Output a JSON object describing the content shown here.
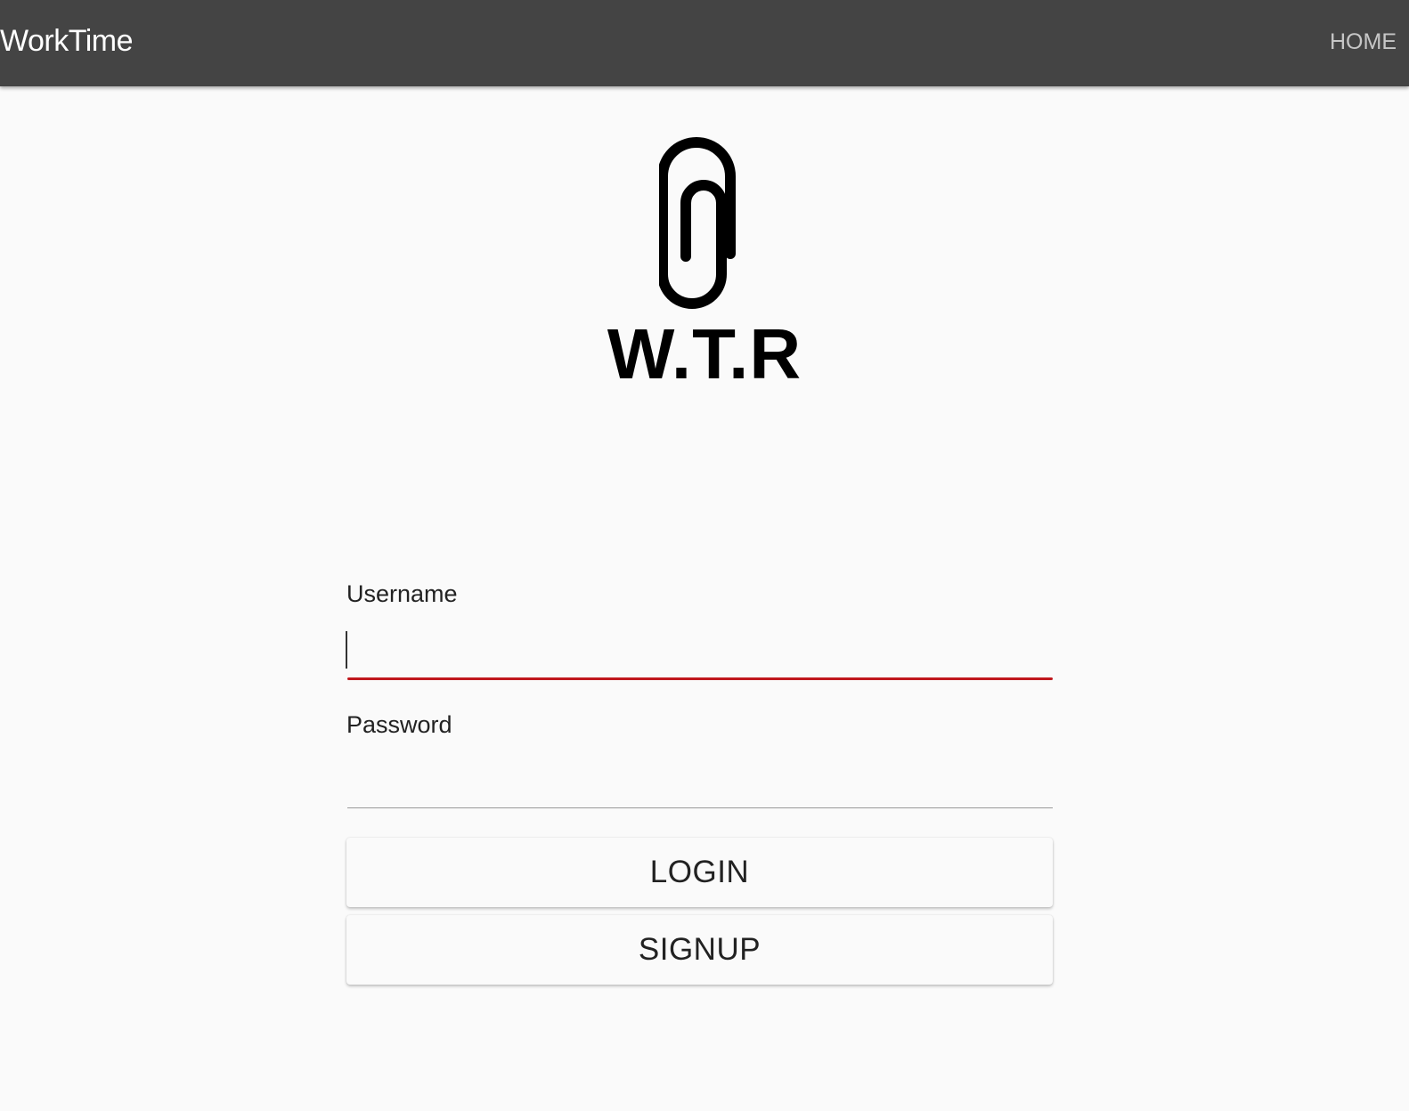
{
  "appbar": {
    "title": "WorkTime",
    "nav_home": "HOME",
    "background": "#444444"
  },
  "logo": {
    "icon": "paperclip-icon",
    "text": "W.T.R"
  },
  "form": {
    "username_label": "Username",
    "username_value": "",
    "username_focused": true,
    "password_label": "Password",
    "password_value": "",
    "focus_color": "#c0181d",
    "login_label": "LOGIN",
    "signup_label": "SIGNUP"
  }
}
